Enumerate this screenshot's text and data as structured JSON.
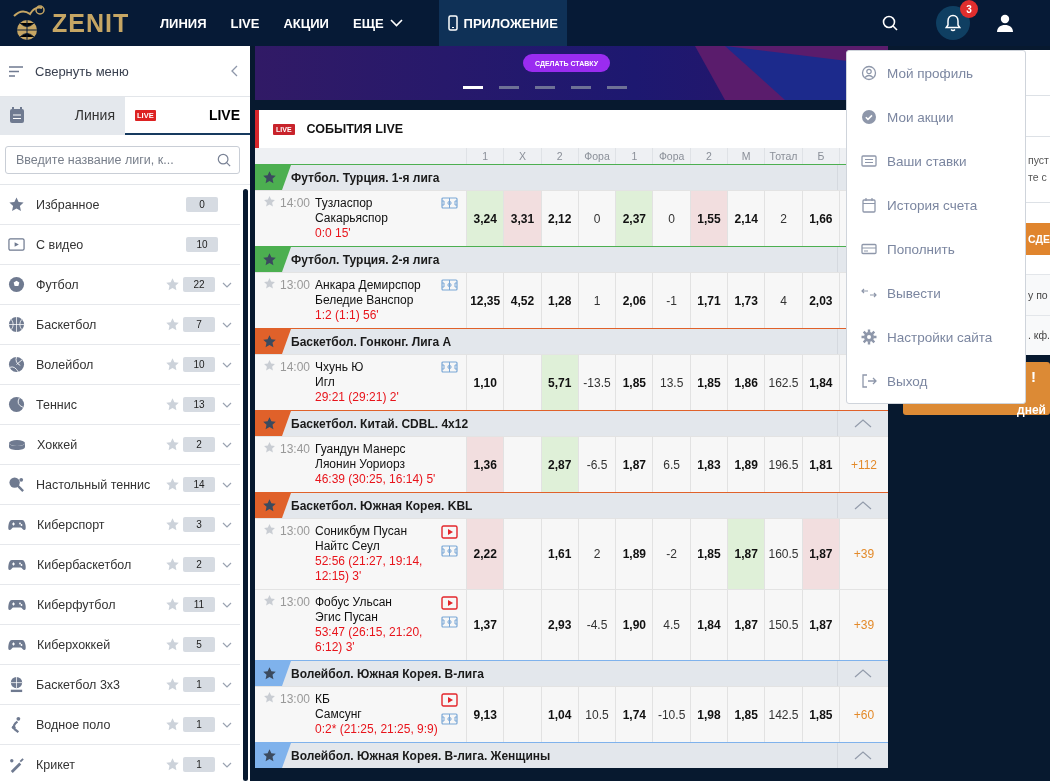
{
  "header": {
    "logo": "ZENIT",
    "nav": [
      {
        "label": "ЛИНИЯ",
        "dropdown": false
      },
      {
        "label": "LIVE",
        "dropdown": false
      },
      {
        "label": "АКЦИИ",
        "dropdown": false
      },
      {
        "label": "ЕЩЕ",
        "dropdown": true
      }
    ],
    "app_button": "ПРИЛОЖЕНИЕ",
    "notifications": "3"
  },
  "sidebar": {
    "collapse": "Свернуть меню",
    "tabs": [
      {
        "label": "Линия",
        "selected": false
      },
      {
        "label": "LIVE",
        "badge": "LIVE",
        "selected": true
      }
    ],
    "search": {
      "placeholder": "Введите название лиги, к..."
    },
    "items": [
      {
        "kind": "special",
        "name": "Избранное",
        "count": "0"
      },
      {
        "kind": "special",
        "name": "С видео",
        "count": "10"
      },
      {
        "kind": "sport",
        "name": "Футбол",
        "count": "22"
      },
      {
        "kind": "sport",
        "name": "Баскетбол",
        "count": "7"
      },
      {
        "kind": "sport",
        "name": "Волейбол",
        "count": "10"
      },
      {
        "kind": "sport",
        "name": "Теннис",
        "count": "13"
      },
      {
        "kind": "sport",
        "name": "Хоккей",
        "count": "2"
      },
      {
        "kind": "sport",
        "name": "Настольный теннис",
        "count": "14"
      },
      {
        "kind": "sport",
        "name": "Киберспорт",
        "count": "3"
      },
      {
        "kind": "sport",
        "name": "Кибербаскетбол",
        "count": "2"
      },
      {
        "kind": "sport",
        "name": "Киберфутбол",
        "count": "11"
      },
      {
        "kind": "sport",
        "name": "Киберхоккей",
        "count": "5"
      },
      {
        "kind": "sport",
        "name": "Баскетбол 3x3",
        "count": "1"
      },
      {
        "kind": "sport",
        "name": "Водное поло",
        "count": "1"
      },
      {
        "kind": "sport",
        "name": "Крикет",
        "count": "1"
      }
    ]
  },
  "banner": {
    "button": "СДЕЛАТЬ СТАВКУ",
    "slides": [
      {
        "selected": true
      },
      {
        "selected": false
      },
      {
        "selected": false
      },
      {
        "selected": false
      },
      {
        "selected": false
      }
    ]
  },
  "live": {
    "badge": "LIVE",
    "title": "СОБЫТИЯ LIVE",
    "columns": [
      {
        "label": "1",
        "kind": "odds"
      },
      {
        "label": "X",
        "kind": "odds"
      },
      {
        "label": "2",
        "kind": "odds"
      },
      {
        "label": "Фора",
        "kind": "param"
      },
      {
        "label": "1",
        "kind": "odds"
      },
      {
        "label": "Фора",
        "kind": "param"
      },
      {
        "label": "2",
        "kind": "odds"
      },
      {
        "label": "М",
        "kind": "odds"
      },
      {
        "label": "Тотал",
        "kind": "param"
      },
      {
        "label": "Б",
        "kind": "odds"
      }
    ],
    "leagues": [
      {
        "title": "Футбол. Турция. 1-я лига",
        "color": "#4caf50",
        "collapsible": false,
        "matches": [
          {
            "time": "14:00",
            "team1": "Тузласпор",
            "team2": "Сакарьяспор",
            "score": "0:0 15'",
            "video": false,
            "stats": true,
            "odds": [
              {
                "kind": "price",
                "value": "3,24",
                "up": true,
                "down": false
              },
              {
                "kind": "price",
                "value": "3,31",
                "up": false,
                "down": true
              },
              {
                "kind": "price",
                "value": "2,12",
                "up": false,
                "down": false
              },
              {
                "kind": "price",
                "value": "0",
                "up": false,
                "down": false
              },
              {
                "kind": "price",
                "value": "2,37",
                "up": true,
                "down": false
              },
              {
                "kind": "price",
                "value": "0",
                "up": false,
                "down": false
              },
              {
                "kind": "price",
                "value": "1,55",
                "up": false,
                "down": true
              },
              {
                "kind": "price",
                "value": "2,14",
                "up": false,
                "down": false
              },
              {
                "kind": "price",
                "value": "2",
                "up": false,
                "down": false
              },
              {
                "kind": "price",
                "value": "1,66",
                "up": false,
                "down": false
              }
            ]
          }
        ]
      },
      {
        "title": "Футбол. Турция. 2-я лига",
        "color": "#4caf50",
        "collapsible": false,
        "matches": [
          {
            "time": "13:00",
            "team1": "Анкара Демирспор",
            "team2": "Беледие Ванспор",
            "score": "1:2 (1:1) 56'",
            "video": false,
            "stats": true,
            "odds": [
              {
                "kind": "price",
                "value": "12,35",
                "up": false,
                "down": false
              },
              {
                "kind": "price",
                "value": "4,52",
                "up": false,
                "down": false
              },
              {
                "kind": "price",
                "value": "1,28",
                "up": false,
                "down": false
              },
              {
                "kind": "price",
                "value": "1",
                "up": false,
                "down": false
              },
              {
                "kind": "price",
                "value": "2,06",
                "up": false,
                "down": false
              },
              {
                "kind": "price",
                "value": "-1",
                "up": false,
                "down": false
              },
              {
                "kind": "price",
                "value": "1,71",
                "up": false,
                "down": false
              },
              {
                "kind": "price",
                "value": "1,73",
                "up": false,
                "down": false
              },
              {
                "kind": "price",
                "value": "4",
                "up": false,
                "down": false
              },
              {
                "kind": "price",
                "value": "2,03",
                "up": false,
                "down": false
              }
            ]
          }
        ]
      },
      {
        "title": "Баскетбол. Гонконг. Лига А",
        "color": "#e0612a",
        "collapsible": false,
        "matches": [
          {
            "time": "14:00",
            "team1": "Чхунь Ю",
            "team2": "Игл",
            "score": "29:21 (29:21) 2'",
            "video": false,
            "stats": true,
            "odds": [
              {
                "kind": "price",
                "value": "1,10",
                "up": false,
                "down": false
              },
              {
                "kind": "empty"
              },
              {
                "kind": "price",
                "value": "5,71",
                "up": true,
                "down": false
              },
              {
                "kind": "price",
                "value": "-13.5",
                "up": false,
                "down": false
              },
              {
                "kind": "price",
                "value": "1,85",
                "up": false,
                "down": false
              },
              {
                "kind": "price",
                "value": "13.5",
                "up": false,
                "down": false
              },
              {
                "kind": "price",
                "value": "1,85",
                "up": false,
                "down": false
              },
              {
                "kind": "price",
                "value": "1,86",
                "up": false,
                "down": false
              },
              {
                "kind": "price",
                "value": "162.5",
                "up": false,
                "down": false
              },
              {
                "kind": "price",
                "value": "1,84",
                "up": false,
                "down": false
              }
            ]
          }
        ]
      },
      {
        "title": "Баскетбол. Китай. CDBL. 4x12",
        "color": "#e0612a",
        "collapsible": true,
        "matches": [
          {
            "time": "13:40",
            "team1": "Гуандун Манерс",
            "team2": "Ляонин Уориорз",
            "score": "46:39 (30:25, 16:14) 5'",
            "video": false,
            "stats": false,
            "more": "+112",
            "odds": [
              {
                "kind": "price",
                "value": "1,36",
                "up": false,
                "down": true
              },
              {
                "kind": "empty"
              },
              {
                "kind": "price",
                "value": "2,87",
                "up": true,
                "down": false
              },
              {
                "kind": "price",
                "value": "-6.5",
                "up": false,
                "down": false
              },
              {
                "kind": "price",
                "value": "1,87",
                "up": false,
                "down": false
              },
              {
                "kind": "price",
                "value": "6.5",
                "up": false,
                "down": false
              },
              {
                "kind": "price",
                "value": "1,83",
                "up": false,
                "down": false
              },
              {
                "kind": "price",
                "value": "1,89",
                "up": false,
                "down": false
              },
              {
                "kind": "price",
                "value": "196.5",
                "up": false,
                "down": false
              },
              {
                "kind": "price",
                "value": "1,81",
                "up": false,
                "down": false
              }
            ]
          }
        ]
      },
      {
        "title": "Баскетбол. Южная Корея. KBL",
        "color": "#e0612a",
        "collapsible": true,
        "matches": [
          {
            "time": "13:00",
            "team1": "Соникбум Пусан",
            "team2": "Найтс Сеул",
            "score": "52:56 (21:27, 19:14, 12:15) 3'",
            "video": true,
            "stats": true,
            "more": "+39",
            "odds": [
              {
                "kind": "price",
                "value": "2,22",
                "up": false,
                "down": true
              },
              {
                "kind": "empty"
              },
              {
                "kind": "price",
                "value": "1,61",
                "up": false,
                "down": false
              },
              {
                "kind": "price",
                "value": "2",
                "up": false,
                "down": false
              },
              {
                "kind": "price",
                "value": "1,89",
                "up": false,
                "down": false
              },
              {
                "kind": "price",
                "value": "-2",
                "up": false,
                "down": false
              },
              {
                "kind": "price",
                "value": "1,85",
                "up": false,
                "down": false
              },
              {
                "kind": "price",
                "value": "1,87",
                "up": true,
                "down": false
              },
              {
                "kind": "price",
                "value": "160.5",
                "up": false,
                "down": false
              },
              {
                "kind": "price",
                "value": "1,87",
                "up": false,
                "down": true
              }
            ]
          },
          {
            "time": "13:00",
            "team1": "Фобус Ульсан",
            "team2": "Эгис Пусан",
            "score": "53:47 (26:15, 21:20, 6:12) 3'",
            "video": true,
            "stats": true,
            "more": "+39",
            "odds": [
              {
                "kind": "price",
                "value": "1,37",
                "up": false,
                "down": false
              },
              {
                "kind": "empty"
              },
              {
                "kind": "price",
                "value": "2,93",
                "up": false,
                "down": false
              },
              {
                "kind": "price",
                "value": "-4.5",
                "up": false,
                "down": false
              },
              {
                "kind": "price",
                "value": "1,90",
                "up": false,
                "down": false
              },
              {
                "kind": "price",
                "value": "4.5",
                "up": false,
                "down": false
              },
              {
                "kind": "price",
                "value": "1,84",
                "up": false,
                "down": false
              },
              {
                "kind": "price",
                "value": "1,87",
                "up": false,
                "down": false
              },
              {
                "kind": "price",
                "value": "150.5",
                "up": false,
                "down": false
              },
              {
                "kind": "price",
                "value": "1,87",
                "up": false,
                "down": false
              }
            ]
          }
        ]
      },
      {
        "title": "Волейбол. Южная Корея. В-лига",
        "color": "#7fb2ec",
        "collapsible": true,
        "matches": [
          {
            "time": "13:00",
            "team1": "КБ",
            "team2": "Самсунг",
            "score": "0:2* (21:25, 21:25, 9:9)",
            "video": true,
            "stats": true,
            "more": "+60",
            "odds": [
              {
                "kind": "price",
                "value": "9,13",
                "up": false,
                "down": false
              },
              {
                "kind": "empty"
              },
              {
                "kind": "price",
                "value": "1,04",
                "up": false,
                "down": false
              },
              {
                "kind": "price",
                "value": "10.5",
                "up": false,
                "down": false
              },
              {
                "kind": "price",
                "value": "1,74",
                "up": false,
                "down": false
              },
              {
                "kind": "price",
                "value": "-10.5",
                "up": false,
                "down": false
              },
              {
                "kind": "price",
                "value": "1,98",
                "up": false,
                "down": false
              },
              {
                "kind": "price",
                "value": "1,85",
                "up": false,
                "down": false
              },
              {
                "kind": "price",
                "value": "142.5",
                "up": false,
                "down": false
              },
              {
                "kind": "price",
                "value": "1,85",
                "up": false,
                "down": false
              }
            ]
          }
        ]
      },
      {
        "title": "Волейбол. Южная Корея. В-лига. Женщины",
        "color": "#7fb2ec",
        "collapsible": true
      }
    ]
  },
  "right_panel": {
    "notice": [
      "пуст",
      "те с"
    ],
    "button": "СДЕ",
    "rows": [
      "у по",
      ". кф."
    ],
    "promo": [
      "!",
      "дней"
    ]
  },
  "account_menu": {
    "items": [
      {
        "label": "Мой профиль"
      },
      {
        "label": "Мои акции"
      },
      {
        "label": "Ваши ставки"
      },
      {
        "label": "История счета"
      },
      {
        "label": "Пополнить"
      },
      {
        "label": "Вывести"
      },
      {
        "label": "Настройки сайта"
      },
      {
        "label": "Выход"
      }
    ]
  }
}
